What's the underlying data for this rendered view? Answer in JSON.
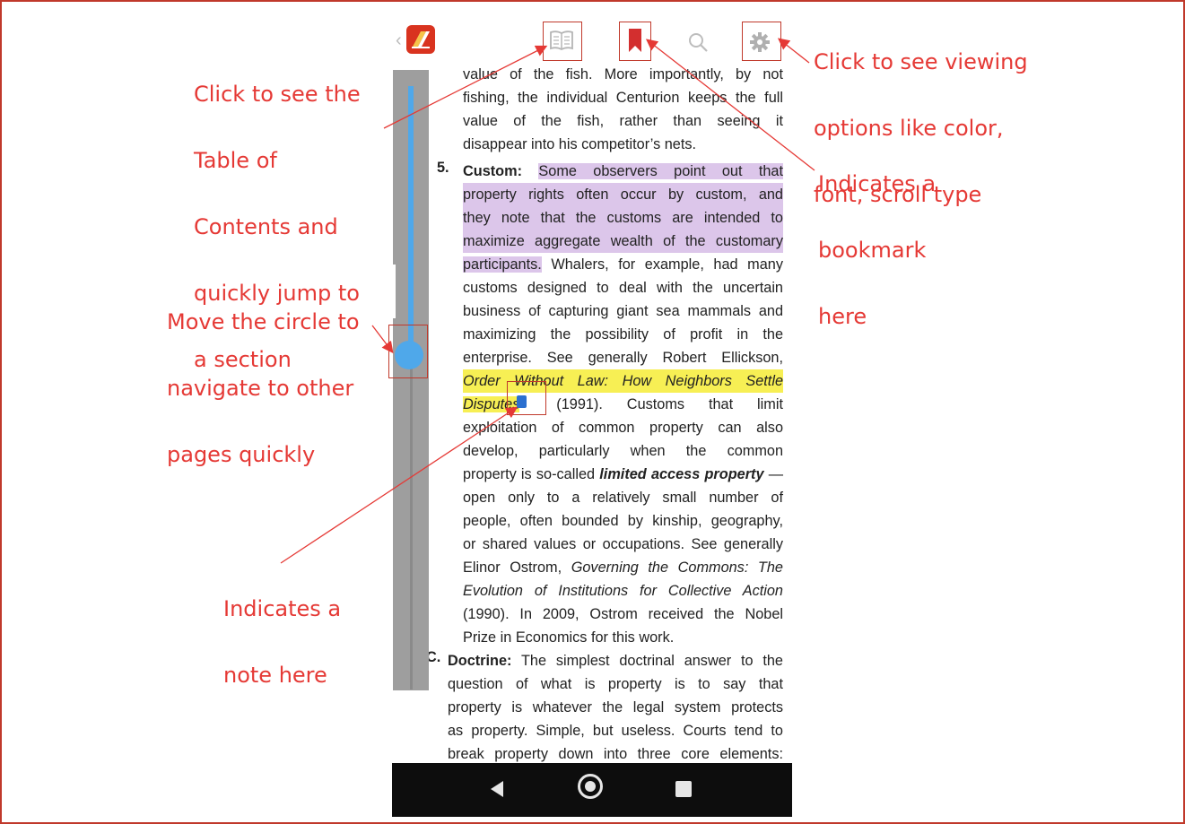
{
  "annotations": {
    "toc": [
      "Click to see the",
      "Table of",
      "Contents and",
      "quickly jump to",
      "a section"
    ],
    "viewing": [
      "Click to see viewing",
      "options like color,",
      "font, scroll type"
    ],
    "bookmark": [
      "Indicates a",
      "bookmark",
      "here"
    ],
    "navigate": [
      "Move the circle to",
      "navigate to other",
      "pages quickly"
    ],
    "note": [
      "Indicates a",
      "note here"
    ]
  },
  "toolbar": {
    "toc_icon": "book-icon",
    "bookmark_icon": "bookmark-icon",
    "search_icon": "search-icon",
    "settings_icon": "gear-icon",
    "bookmark_color": "#d32f2f"
  },
  "scrollbar": {
    "position": 0.45,
    "color": "#4fa8ea"
  },
  "content": {
    "top_lines": [
      "value of the fish. More importantly, by not",
      "fishing, the individual Centurion keeps the full",
      "value of the fish, rather than seeing it",
      "disappear into his competitor’s nets."
    ],
    "item5_number": "5.",
    "item5_label": "Custom:",
    "item5_highlight_1": "Some observers point out that",
    "item5_highlight_lines": [
      "property rights often occur by custom, and",
      "they note that the customs are intended to",
      "maximize aggregate wealth of the customary"
    ],
    "item5_highlight_end": "participants.",
    "item5_after_highlight": " Whalers, for example, had many",
    "item5_lines_a": [
      "customs designed to deal with the uncertain",
      "business of capturing giant sea mammals and",
      "maximizing the possibility of profit in the",
      "enterprise. See generally Robert Ellickson,"
    ],
    "item5_yellow_1": "Order Without Law: How Neighbors Settle",
    "item5_yellow_2": "Disputes",
    "item5_after_yellow": " (1991). Customs that limit",
    "item5_lines_b": [
      "exploitation of common property can also",
      "develop, particularly when the common"
    ],
    "item5_bold_prefix": "property is so-called ",
    "item5_bold": "limited access property",
    "item5_bold_suffix": " —",
    "item5_lines_c": [
      "open only to a relatively small number of",
      "people, often bounded by kinship, geography,",
      "or shared values or occupations. See generally"
    ],
    "item5_italic_prefix": "Elinor Ostrom, ",
    "item5_italic_1": "Governing the Commons: The",
    "item5_italic_2": "Evolution of Institutions for Collective Action",
    "item5_lines_d": [
      "(1990). In 2009, Ostrom received the Nobel",
      "Prize in Economics for this work."
    ],
    "itemC_number": "C.",
    "itemC_label": "Doctrine:",
    "itemC_first": " The simplest doctrinal answer to the",
    "itemC_lines": [
      "question of what is property is to say that",
      "property is whatever the legal system protects",
      "as property. Simple, but useless. Courts tend to",
      "break property down into three core elements:"
    ]
  },
  "colors": {
    "annotation": "#e53935",
    "highlight_purple": "#dcc6ea",
    "highlight_yellow": "#f7ef54",
    "note": "#2b6fcf"
  }
}
